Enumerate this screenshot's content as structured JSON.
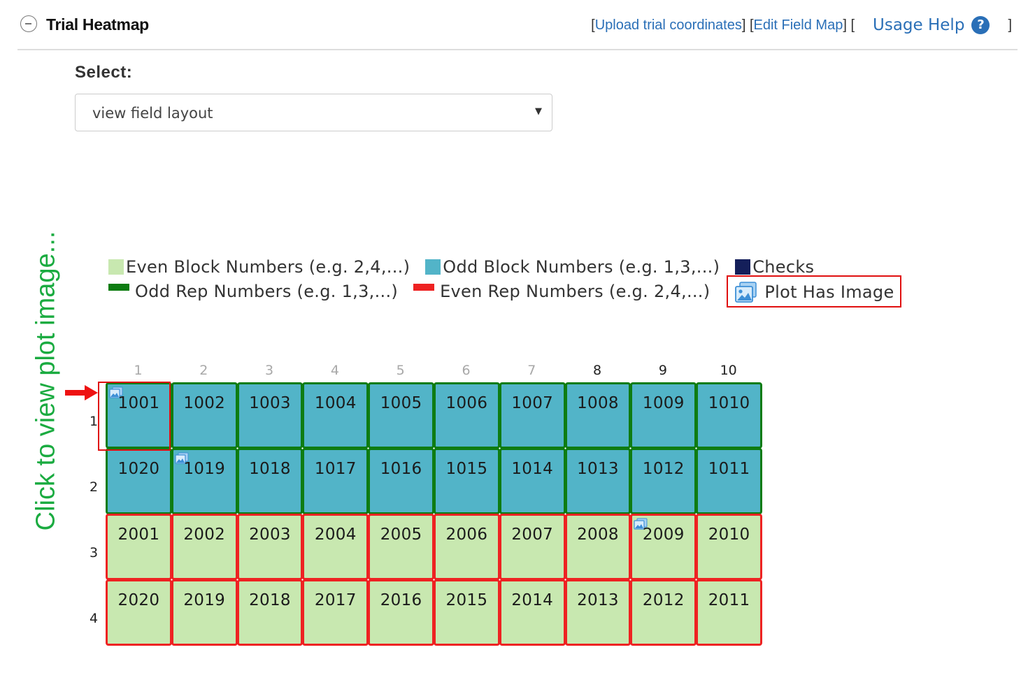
{
  "header": {
    "title": "Trial Heatmap",
    "open_bracket_1": "[",
    "upload_link": "Upload trial coordinates",
    "mid_bracket": "] [",
    "edit_link": "Edit Field Map",
    "trailing_bracket": "] [",
    "usage_help": "Usage Help",
    "help_icon_glyph": "?",
    "close_bracket": "]"
  },
  "select": {
    "label": "Select:",
    "value": "view field layout",
    "caret": "▼"
  },
  "annotation": {
    "side_text": "Click to view plot image...",
    "color": "#1aab40"
  },
  "legend": {
    "row1": [
      {
        "label": "Even Block Numbers (e.g. 2,4,...)",
        "color": "#c8e8b0",
        "style": "square"
      },
      {
        "label": "Odd Block Numbers (e.g. 1,3,...)",
        "color": "#52b4c8",
        "style": "square"
      },
      {
        "label": "Checks",
        "color": "#141f5a",
        "style": "square"
      }
    ],
    "row2": [
      {
        "label": "Odd Rep Numbers (e.g. 1,3,...)",
        "color": "#0e7c12",
        "style": "line"
      },
      {
        "label": "Even Rep Numbers (e.g. 2,4,...)",
        "color": "#ee2222",
        "style": "line"
      }
    ],
    "image_label": "Plot Has Image",
    "image_icon": "picture-icon"
  },
  "heatmap": {
    "columns": [
      "1",
      "2",
      "3",
      "4",
      "5",
      "6",
      "7",
      "8",
      "9",
      "10"
    ],
    "column_label_colors": [
      "#a8a8a8",
      "#a8a8a8",
      "#a8a8a8",
      "#a8a8a8",
      "#a8a8a8",
      "#a8a8a8",
      "#a8a8a8",
      "#222222",
      "#222222",
      "#222222"
    ],
    "rows": [
      {
        "label": "1",
        "plots": [
          "1001",
          "1002",
          "1003",
          "1004",
          "1005",
          "1006",
          "1007",
          "1008",
          "1009",
          "1010"
        ]
      },
      {
        "label": "2",
        "plots": [
          "1020",
          "1019",
          "1018",
          "1017",
          "1016",
          "1015",
          "1014",
          "1013",
          "1012",
          "1011"
        ]
      },
      {
        "label": "3",
        "plots": [
          "2001",
          "2002",
          "2003",
          "2004",
          "2005",
          "2006",
          "2007",
          "2008",
          "2009",
          "2010"
        ]
      },
      {
        "label": "4",
        "plots": [
          "2020",
          "2019",
          "2018",
          "2017",
          "2016",
          "2015",
          "2014",
          "2013",
          "2012",
          "2011"
        ]
      }
    ],
    "rep_border_colors": [
      "#0e7c12",
      "#0e7c12",
      "#ee2222",
      "#ee2222"
    ],
    "block_fill_colors": [
      "#52b4c8",
      "#52b4c8",
      "#c8e8b0",
      "#c8e8b0"
    ],
    "plots_with_image": [
      "1001",
      "1019",
      "2009"
    ],
    "highlighted_plot": "1001",
    "highlight_color": "#e01010"
  }
}
